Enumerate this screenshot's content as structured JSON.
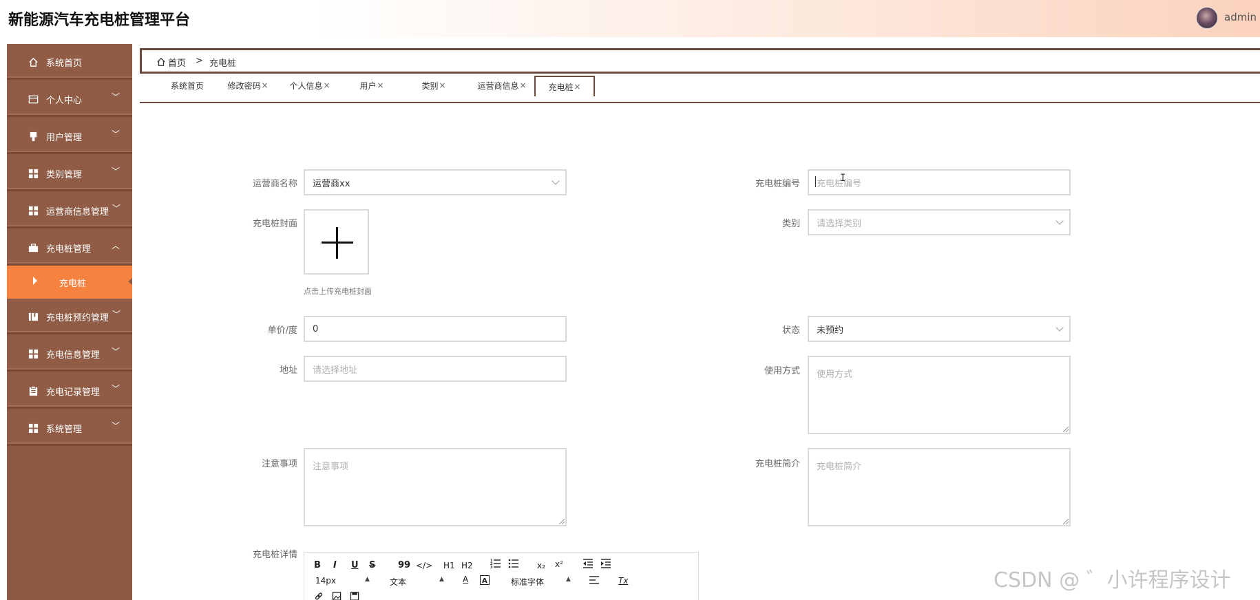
{
  "app": {
    "title": "新能源汽车充电桩管理平台",
    "user": "admin"
  },
  "sidebar": {
    "items": [
      {
        "label": "系统首页",
        "icon": "home-icon"
      },
      {
        "label": "个人中心",
        "icon": "card-icon"
      },
      {
        "label": "用户管理",
        "icon": "user-icon"
      },
      {
        "label": "类别管理",
        "icon": "grid-icon"
      },
      {
        "label": "运营商信息管理",
        "icon": "grid-icon"
      },
      {
        "label": "充电桩管理",
        "icon": "briefcase-icon"
      },
      {
        "label": "充电桩预约管理",
        "icon": "book-icon"
      },
      {
        "label": "充电信息管理",
        "icon": "grid-icon"
      },
      {
        "label": "充电记录管理",
        "icon": "clipboard-icon"
      },
      {
        "label": "系统管理",
        "icon": "grid-icon"
      }
    ],
    "active_sub": "充电桩"
  },
  "breadcrumb": {
    "home": "首页",
    "separator": ">",
    "current": "充电桩"
  },
  "tabs": [
    {
      "label": "系统首页",
      "closable": false
    },
    {
      "label": "修改密码",
      "closable": true
    },
    {
      "label": "个人信息",
      "closable": true
    },
    {
      "label": "用户",
      "closable": true
    },
    {
      "label": "类别",
      "closable": true
    },
    {
      "label": "运营商信息",
      "closable": true
    },
    {
      "label": "充电桩",
      "closable": true,
      "active": true
    }
  ],
  "tab_close": "×",
  "form": {
    "operator_name": {
      "label": "运营商名称",
      "value": "运营商xx"
    },
    "pile_number": {
      "label": "充电桩编号",
      "placeholder": "充电桩编号"
    },
    "cover": {
      "label": "充电桩封面",
      "hint": "点击上传充电桩封面"
    },
    "category": {
      "label": "类别",
      "placeholder": "请选择类别"
    },
    "unit_price": {
      "label": "单价/度",
      "value": "0"
    },
    "status": {
      "label": "状态",
      "value": "未预约"
    },
    "address": {
      "label": "地址",
      "placeholder": "请选择地址"
    },
    "usage": {
      "label": "使用方式",
      "placeholder": "使用方式"
    },
    "notes": {
      "label": "注意事项",
      "placeholder": "注意事项"
    },
    "intro": {
      "label": "充电桩简介",
      "placeholder": "充电桩简介"
    },
    "details": {
      "label": "充电桩详情"
    }
  },
  "editor": {
    "bold": "B",
    "italic": "I",
    "underline": "U",
    "strike": "S",
    "quote": "99",
    "code": "</>",
    "h1": "H1",
    "h2": "H2",
    "sub": "x₂",
    "sup": "x²",
    "font_size": "14px",
    "block_type": "文本",
    "font_family": "标准字体",
    "font_color": "A",
    "clear": "Tx"
  },
  "watermark": "CSDN @ ゛小许程序设计",
  "colors": {
    "sidebar": "#8e5a45",
    "active": "#f5823e",
    "border": "#6b4a3e"
  }
}
